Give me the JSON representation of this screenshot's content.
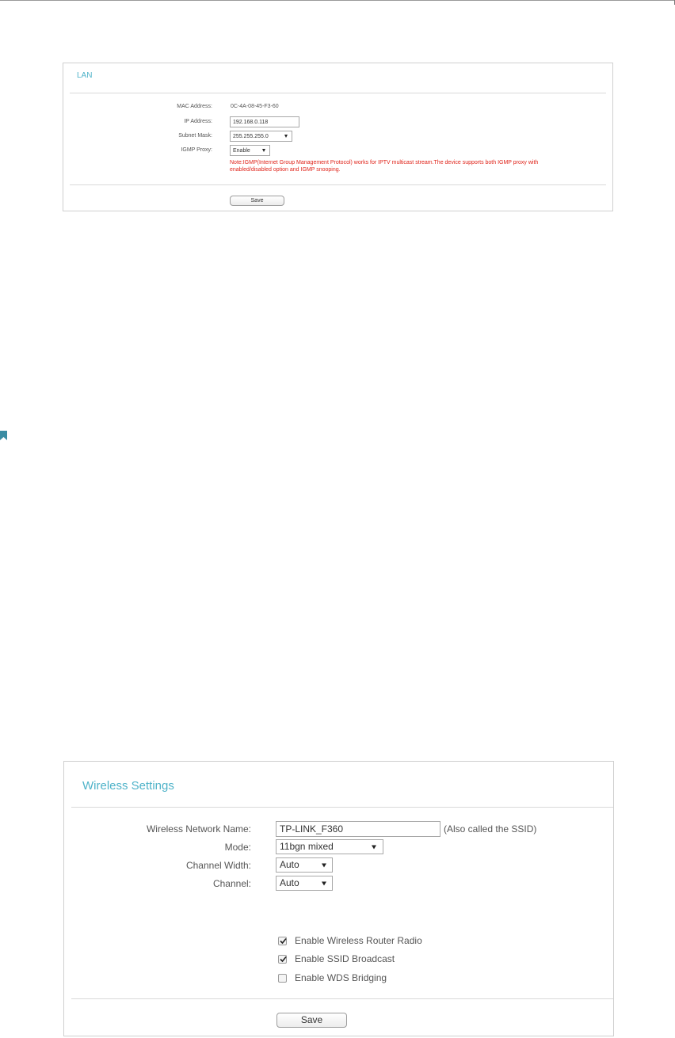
{
  "lan": {
    "title": "LAN",
    "mac_label": "MAC Address:",
    "mac_value": "0C-4A-08-45-F3-60",
    "ip_label": "IP Address:",
    "ip_value": "192.168.0.118",
    "subnet_label": "Subnet Mask:",
    "subnet_value": "255.255.255.0",
    "igmp_label": "IGMP Proxy:",
    "igmp_value": "Enable",
    "note_line1": "Note:IGMP(Internet Group Management Protocol) works for IPTV multicast stream.The device supports both IGMP proxy with",
    "note_line2": "enabled/disabled option and IGMP snooping.",
    "save_label": "Save"
  },
  "wireless": {
    "title": "Wireless Settings",
    "ssid_label": "Wireless Network Name:",
    "ssid_value": "TP-LINK_F360",
    "ssid_hint": "(Also called the SSID)",
    "mode_label": "Mode:",
    "mode_value": "11bgn mixed",
    "width_label": "Channel Width:",
    "width_value": "Auto",
    "channel_label": "Channel:",
    "channel_value": "Auto",
    "checkboxes": [
      {
        "label": "Enable Wireless Router Radio",
        "checked": true
      },
      {
        "label": "Enable SSID Broadcast",
        "checked": true
      },
      {
        "label": "Enable WDS Bridging",
        "checked": false
      }
    ],
    "save_label": "Save"
  },
  "colors": {
    "title_accent": "#4fb3c9",
    "note_red": "#e0241a",
    "bookmark": "#3a8ca3"
  },
  "icons": {
    "bookmark": "bookmark-icon",
    "dropdown": "chevron-down-icon",
    "checkmark": "checkmark-icon"
  }
}
